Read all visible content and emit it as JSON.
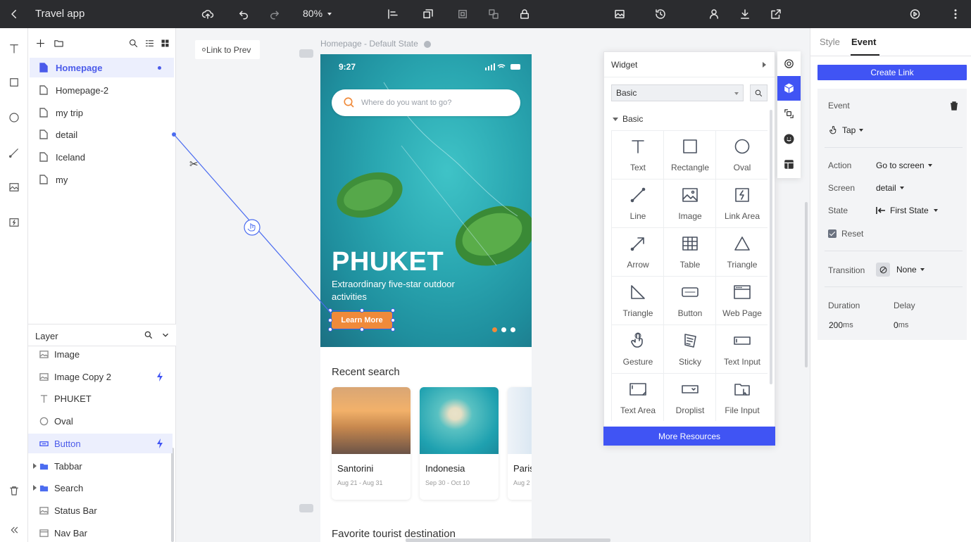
{
  "topbar": {
    "app_title": "Travel app",
    "zoom": "80%"
  },
  "pages": {
    "items": [
      {
        "label": "Homepage",
        "active": true
      },
      {
        "label": "Homepage-2"
      },
      {
        "label": "my trip"
      },
      {
        "label": "detail"
      },
      {
        "label": "Iceland"
      },
      {
        "label": "my"
      }
    ]
  },
  "layers": {
    "title": "Layer",
    "items": [
      {
        "label": "Image",
        "icon": "image-icon"
      },
      {
        "label": "Image Copy 2",
        "icon": "image-icon",
        "has_event": true
      },
      {
        "label": "PHUKET",
        "icon": "text-icon"
      },
      {
        "label": "Oval",
        "icon": "oval-icon"
      },
      {
        "label": "Button",
        "icon": "button-icon",
        "has_event": true,
        "selected": true
      },
      {
        "label": "Tabbar",
        "icon": "folder-icon",
        "group": true
      },
      {
        "label": "Search",
        "icon": "folder-icon",
        "group": true
      },
      {
        "label": "Status Bar",
        "icon": "image-icon"
      },
      {
        "label": "Nav Bar",
        "icon": "frame-icon"
      }
    ]
  },
  "canvas": {
    "link_to_prev": "Link to Prev",
    "frame_title": "Homepage - Default State"
  },
  "phone": {
    "status_time": "9:27",
    "search_placeholder": "Where do you want to go?",
    "hero_title": "PHUKET",
    "hero_subtitle": "Extraordinary five-star outdoor activities",
    "cta_label": "Learn More",
    "recent_title": "Recent search",
    "cards": [
      {
        "name": "Santorini",
        "date": "Aug 21 - Aug 31"
      },
      {
        "name": "Indonesia",
        "date": "Sep 30 - Oct 10"
      },
      {
        "name": "Paris",
        "date": "Aug 2"
      }
    ],
    "favorite_title": "Favorite tourist destination"
  },
  "widget_panel": {
    "title": "Widget",
    "library_select": "Basic",
    "section": "Basic",
    "widgets": [
      {
        "label": "Text",
        "icon": "text-icon"
      },
      {
        "label": "Rectangle",
        "icon": "rectangle-icon"
      },
      {
        "label": "Oval",
        "icon": "oval-icon"
      },
      {
        "label": "Line",
        "icon": "line-icon"
      },
      {
        "label": "Image",
        "icon": "image-icon"
      },
      {
        "label": "Link Area",
        "icon": "link-area-icon"
      },
      {
        "label": "Arrow",
        "icon": "arrow-icon"
      },
      {
        "label": "Table",
        "icon": "table-icon"
      },
      {
        "label": "Triangle",
        "icon": "triangle-icon"
      },
      {
        "label": "Triangle",
        "icon": "right-triangle-icon"
      },
      {
        "label": "Button",
        "icon": "button-icon"
      },
      {
        "label": "Web Page",
        "icon": "web-page-icon"
      },
      {
        "label": "Gesture",
        "icon": "gesture-icon"
      },
      {
        "label": "Sticky",
        "icon": "sticky-icon"
      },
      {
        "label": "Text Input",
        "icon": "text-input-icon"
      },
      {
        "label": "Text Area",
        "icon": "text-area-icon"
      },
      {
        "label": "Droplist",
        "icon": "droplist-icon"
      },
      {
        "label": "File Input",
        "icon": "file-input-icon"
      }
    ],
    "more_resources": "More Resources"
  },
  "inspector": {
    "tabs": [
      "Style",
      "Event"
    ],
    "active_tab": "Event",
    "create_link": "Create Link",
    "event_label": "Event",
    "event_value": "Tap",
    "action_label": "Action",
    "action_value": "Go to screen",
    "screen_label": "Screen",
    "screen_value": "detail",
    "state_label": "State",
    "state_value": "First State",
    "reset_label": "Reset",
    "transition_label": "Transition",
    "transition_value": "None",
    "duration_label": "Duration",
    "duration_value": "200",
    "delay_label": "Delay",
    "delay_value": "0",
    "unit": "ms"
  },
  "colors": {
    "accent": "#4054f4",
    "cta": "#f08a3a",
    "topbar": "#2b2c2f"
  }
}
